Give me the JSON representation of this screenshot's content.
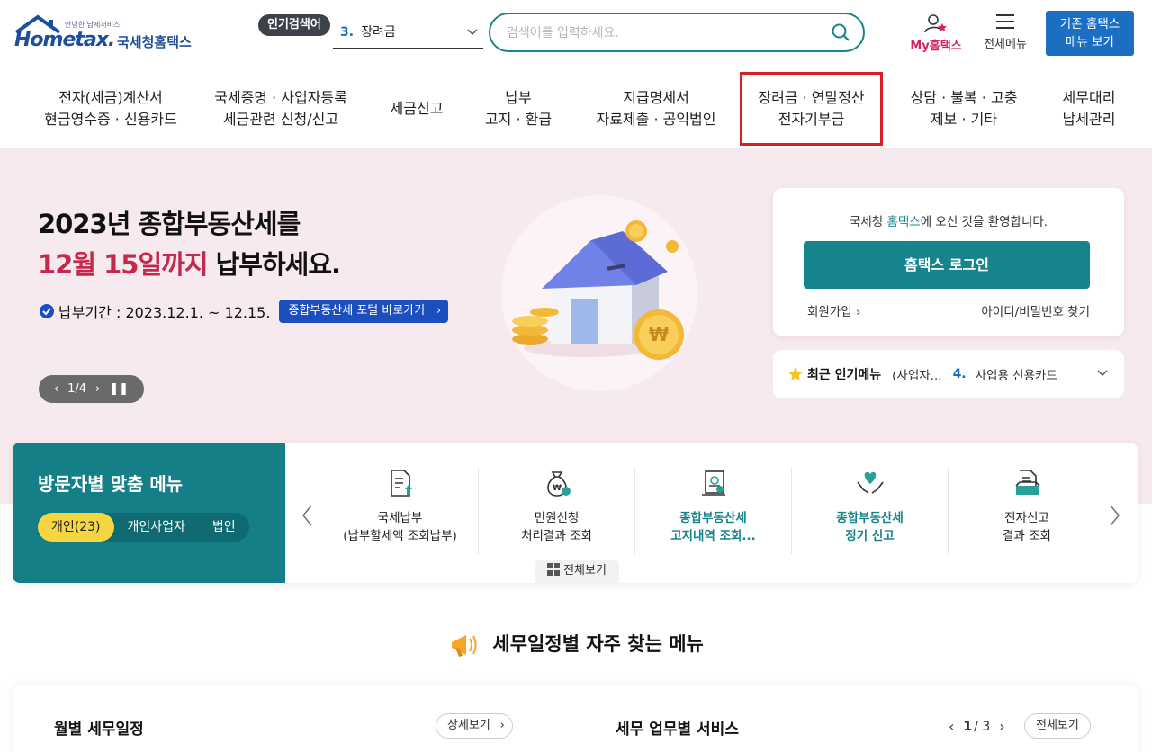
{
  "header": {
    "logo_tagline": "안녕한 납세서비스",
    "logo_brand": "Hometax.",
    "logo_sub": "국세청홈택스",
    "popular_label": "인기검색어",
    "popular_num": "3.",
    "popular_term": "장려금",
    "search_placeholder": "검색어를 입력하세요.",
    "my_hometax": "My홈택스",
    "all_menu": "전체메뉴",
    "old_menu_line1": "기존 홈택스",
    "old_menu_line2": "메뉴 보기"
  },
  "nav": {
    "items": [
      {
        "line1": "전자(세금)계산서",
        "line2": "현금영수증 · 신용카드"
      },
      {
        "line1": "국세증명 · 사업자등록",
        "line2": "세금관련 신청/신고"
      },
      {
        "line1": "세금신고",
        "line2": ""
      },
      {
        "line1": "납부",
        "line2": "고지 · 환급"
      },
      {
        "line1": "지급명세서",
        "line2": "자료제출 · 공익법인"
      },
      {
        "line1": "장려금 · 연말정산",
        "line2": "전자기부금"
      },
      {
        "line1": "상담 · 불복 · 고충",
        "line2": "제보 · 기타"
      },
      {
        "line1": "세무대리",
        "line2": "납세관리"
      }
    ]
  },
  "hero": {
    "title_line1": "2023년 종합부동산세를",
    "title_accent": "12월 15일까지",
    "title_rest": " 납부하세요.",
    "period": "납부기간 : 2023.12.1. ~ 12.15.",
    "portal_button": "종합부동산세 포털 바로가기",
    "slide_counter": "1/4"
  },
  "login": {
    "welcome_prefix": "국세청 ",
    "welcome_brand": "홈택스",
    "welcome_suffix": "에 오신 것을 환영합니다.",
    "login_button": "홈택스 로그인",
    "signup": "회원가입",
    "find_account": "아이디/비밀번호 찾기"
  },
  "recent": {
    "label": "최근 인기메뉴",
    "sub": "(사업자...",
    "num": "4.",
    "item": "사업용 신용카드"
  },
  "visitor": {
    "title": "방문자별 맞춤 메뉴",
    "tabs": [
      "개인(23)",
      "개인사업자",
      "법인"
    ],
    "items": [
      {
        "line1": "국세납부",
        "line2": "(납부할세액 조회납부)",
        "icon": "tax-payment-icon"
      },
      {
        "line1": "민원신청",
        "line2": "처리결과 조회",
        "icon": "money-bag-icon"
      },
      {
        "line1": "종합부동산세",
        "line2": "고지내역 조회...",
        "icon": "notice-document-icon"
      },
      {
        "line1": "종합부동산세",
        "line2": "정기 신고",
        "icon": "heart-hands-icon"
      },
      {
        "line1": "전자신고",
        "line2": "결과 조회",
        "icon": "file-result-icon"
      }
    ],
    "view_all": "전체보기"
  },
  "schedule": {
    "heading": "세무일정별 자주 찾는 메뉴",
    "monthly": "월별 세무일정",
    "detail": "상세보기",
    "service": "세무 업무별 서비스",
    "page_current": "1",
    "page_total": "/ 3",
    "view_all": "전체보기"
  }
}
